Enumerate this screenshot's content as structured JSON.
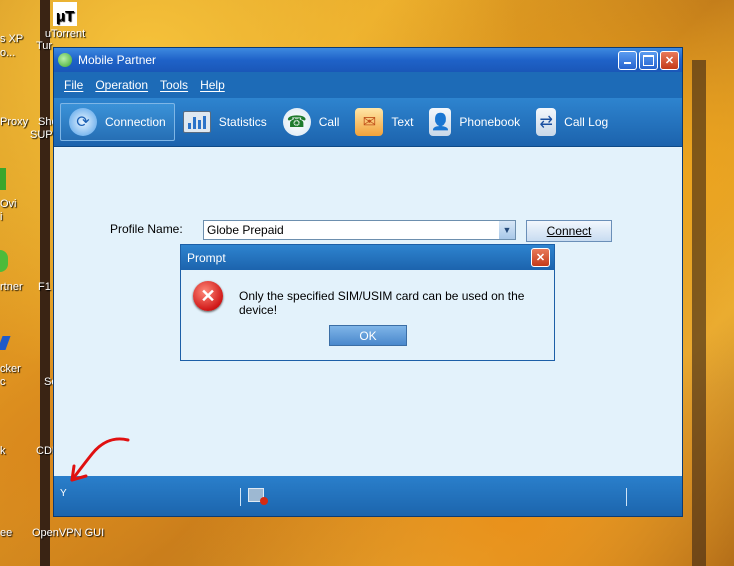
{
  "desktop": {
    "icons": [
      {
        "label": "uTorrent",
        "sub": "Tur"
      }
    ],
    "partial_labels": [
      "s XP",
      "o...",
      "Proxy",
      "Sho",
      "SUPE",
      "Ovi",
      "i",
      "rtner",
      "F1",
      "cker",
      "c",
      "Se",
      "k",
      "CDE",
      "ee",
      "OpenVPN GUI"
    ]
  },
  "window": {
    "title": "Mobile Partner",
    "menu": [
      "File",
      "Operation",
      "Tools",
      "Help"
    ],
    "toolbar": [
      {
        "label": "Connection",
        "icon": "refresh-icon",
        "active": true
      },
      {
        "label": "Statistics",
        "icon": "monitor-icon"
      },
      {
        "label": "Call",
        "icon": "phone-icon"
      },
      {
        "label": "Text",
        "icon": "envelope-icon"
      },
      {
        "label": "Phonebook",
        "icon": "contact-book-icon"
      },
      {
        "label": "Call Log",
        "icon": "call-log-icon"
      }
    ],
    "profile_label": "Profile Name:",
    "profile_value": "Globe Prepaid",
    "connect_label": "Connect"
  },
  "prompt": {
    "title": "Prompt",
    "message": "Only the specified SIM/USIM card can be used on the device!",
    "ok_label": "OK"
  },
  "colors": {
    "accent_blue": "#1d6bb7",
    "error_red": "#d01818"
  }
}
